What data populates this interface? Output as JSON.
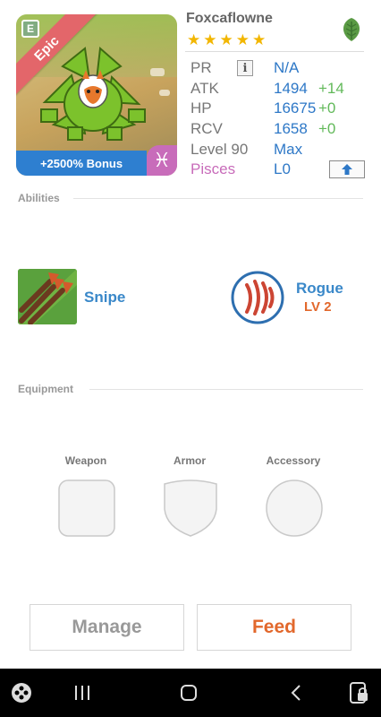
{
  "hero": {
    "rarity_badge": "E",
    "rarity": "Epic",
    "bonus": "+2500% Bonus",
    "zodiac_symbol": "♓"
  },
  "monster": {
    "name": "Foxcaflowne",
    "star_count": 5,
    "element_icon": "leaf-icon"
  },
  "stats": {
    "pr": {
      "label": "PR",
      "value": "N/A"
    },
    "atk": {
      "label": "ATK",
      "value": "1494",
      "bonus": "+14"
    },
    "hp": {
      "label": "HP",
      "value": "16675",
      "bonus": "+0"
    },
    "rcv": {
      "label": "RCV",
      "value": "1658",
      "bonus": "+0"
    },
    "level": {
      "label": "Level 90",
      "value": "Max"
    },
    "sign": {
      "label": "Pisces",
      "value": "L0"
    }
  },
  "colors": {
    "accent_blue": "#2e78c7",
    "bonus_green": "#62b95a",
    "feed_orange": "#e2682c",
    "pisces_pink": "#c86cba",
    "epic_red": "#e3666a"
  },
  "abilities": {
    "title": "Abilities",
    "skill": {
      "name": "Snipe"
    },
    "class": {
      "name": "Rogue",
      "level": "LV 2"
    }
  },
  "equipment": {
    "title": "Equipment",
    "slots": [
      {
        "label": "Weapon"
      },
      {
        "label": "Armor"
      },
      {
        "label": "Accessory"
      }
    ]
  },
  "actions": {
    "manage": "Manage",
    "feed": "Feed"
  },
  "navbar": {
    "icons": [
      "game-pad-icon",
      "recent-apps-icon",
      "home-icon",
      "back-icon",
      "screen-lock-icon"
    ]
  }
}
